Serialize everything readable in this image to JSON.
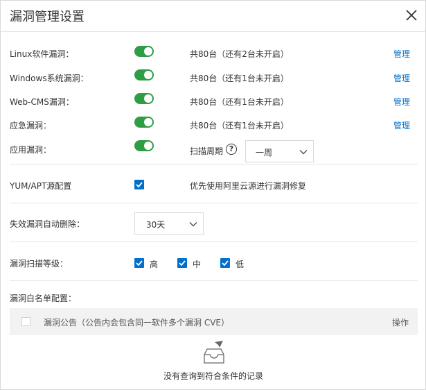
{
  "dialog": {
    "title": "漏洞管理设置"
  },
  "vuln_rows": [
    {
      "label": "Linux软件漏洞：",
      "enabled": true,
      "summary": "共80台（还有2台未开启）",
      "action": "管理"
    },
    {
      "label": "Windows系统漏洞：",
      "enabled": true,
      "summary": "共80台（还有1台未开启）",
      "action": "管理"
    },
    {
      "label": "Web-CMS漏洞：",
      "enabled": true,
      "summary": "共80台（还有1台未开启）",
      "action": "管理"
    },
    {
      "label": "应急漏洞：",
      "enabled": true,
      "summary": "共80台（还有1台未开启）",
      "action": "管理"
    }
  ],
  "app_vuln": {
    "label": "应用漏洞：",
    "enabled": true,
    "scan_cycle_label": "扫描周期",
    "help_glyph": "?",
    "scan_cycle_value": "一周"
  },
  "yum_apt": {
    "label": "YUM/APT源配置",
    "checked": true,
    "text": "优先使用阿里云源进行漏洞修复"
  },
  "auto_delete": {
    "label": "失效漏洞自动删除：",
    "value": "30天"
  },
  "scan_level": {
    "label": "漏洞扫描等级：",
    "options": [
      {
        "text": "高",
        "checked": true
      },
      {
        "text": "中",
        "checked": true
      },
      {
        "text": "低",
        "checked": true
      }
    ]
  },
  "whitelist": {
    "label": "漏洞白名单配置：",
    "col_name": "漏洞公告（公告内会包含同一软件多个漏洞 CVE）",
    "col_action": "操作",
    "empty_text": "没有查询到符合条件的记录"
  },
  "colors": {
    "toggle_on": "#2e9d43",
    "link": "#0070cc",
    "checkbox": "#0070cc"
  },
  "icons": {
    "close": "close-icon",
    "chevron": "chevron-down-icon",
    "help": "help-circle-icon",
    "empty": "empty-inbox-icon"
  }
}
